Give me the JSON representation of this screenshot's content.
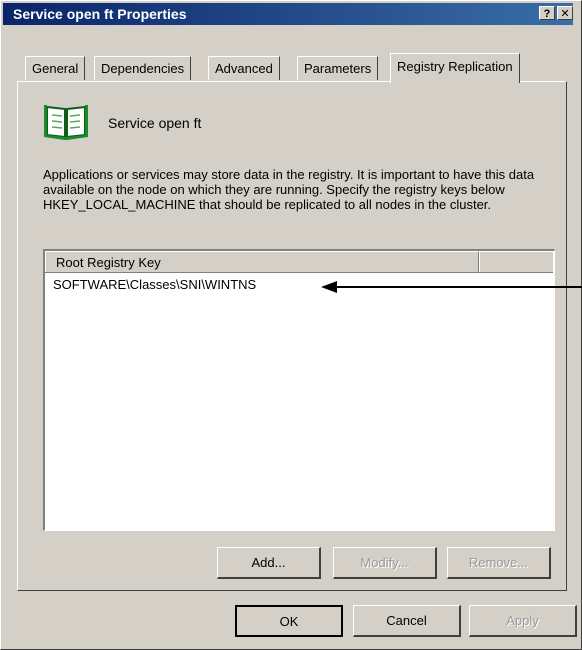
{
  "window": {
    "title": "Service open ft  Properties",
    "help_button": "?",
    "close_button": "✕"
  },
  "tabs": [
    {
      "label": "General",
      "active": false
    },
    {
      "label": "Dependencies",
      "active": false
    },
    {
      "label": "Advanced",
      "active": false
    },
    {
      "label": "Parameters",
      "active": false
    },
    {
      "label": "Registry Replication",
      "active": true
    }
  ],
  "service": {
    "icon": "open-book-icon",
    "name": "Service open ft"
  },
  "description": "Applications or services may store data in the registry. It is important to have this data available on the node on which they are running. Specify the registry keys below HKEY_LOCAL_MACHINE that should be replicated to all nodes in the cluster.",
  "registry_list": {
    "column_header": "Root Registry Key",
    "rows": [
      "SOFTWARE\\Classes\\SNI\\WINTNS"
    ]
  },
  "list_buttons": {
    "add": "Add...",
    "modify": "Modify...",
    "remove": "Remove..."
  },
  "dialog_buttons": {
    "ok": "OK",
    "cancel": "Cancel",
    "apply": "Apply"
  },
  "colors": {
    "title_bar": "#0a246a",
    "face": "#d4d0c8",
    "icon_green": "#1a8a2a"
  }
}
